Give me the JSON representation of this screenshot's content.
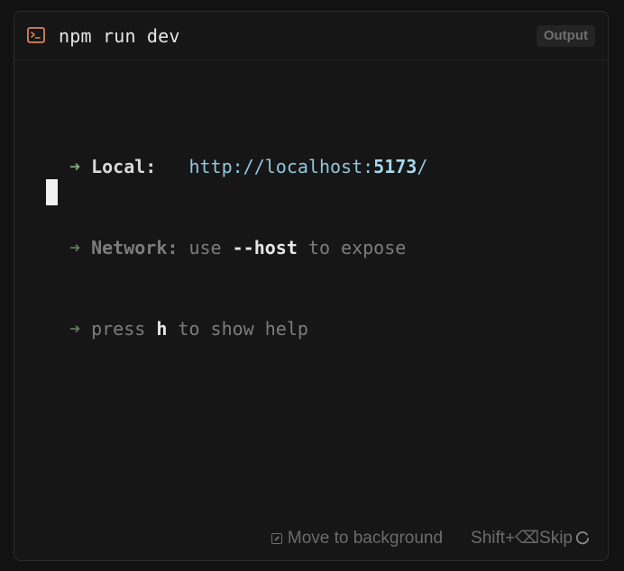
{
  "header": {
    "icon": "terminal-icon",
    "title": "npm run dev",
    "badge": "Output"
  },
  "terminal": {
    "lines": [
      {
        "arrow": "➜",
        "label": "Local:",
        "pad": "   ",
        "url_prefix": "http://localhost:",
        "url_port": "5173",
        "url_suffix": "/"
      },
      {
        "arrow": "➜",
        "label": "Network:",
        "text_a": " use ",
        "keyword": "--host",
        "text_b": " to expose"
      },
      {
        "arrow": "➜",
        "text_a": "press ",
        "keyword": "h",
        "text_b": " to show help"
      }
    ]
  },
  "footer": {
    "background_label": "Move to background",
    "shift_label": "Shift+⌫",
    "skip_label": "Skip"
  },
  "colors": {
    "accent_icon": "#d9835f",
    "arrow": "#7fa67a",
    "url": "#8fc6e0"
  }
}
